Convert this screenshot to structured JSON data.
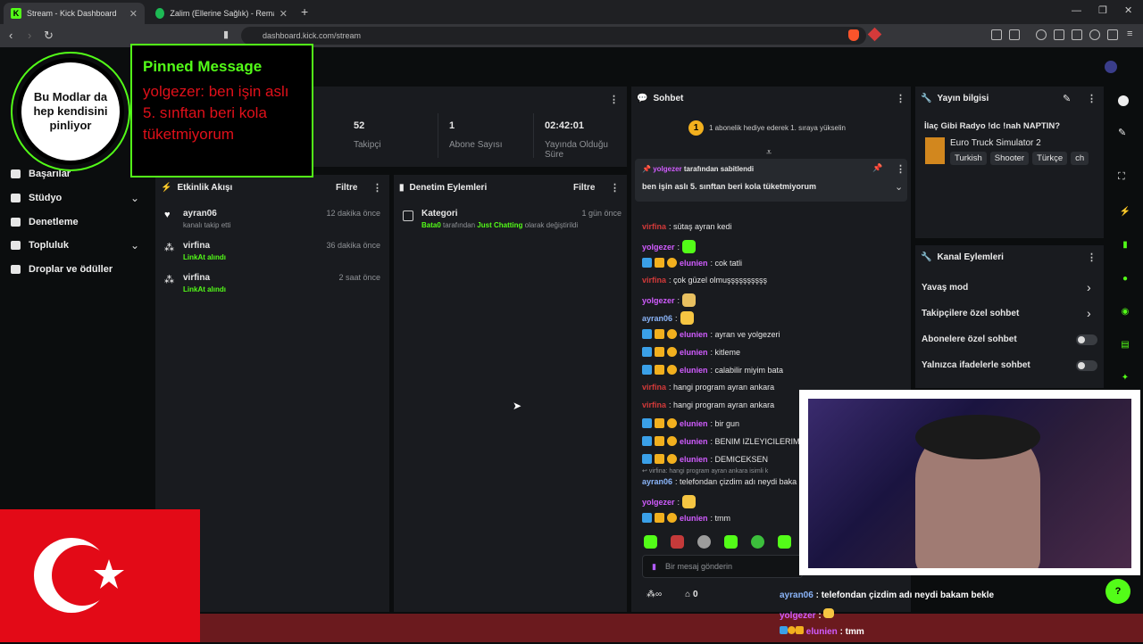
{
  "browser": {
    "tabs": [
      {
        "title": "Stream - Kick Dashboard",
        "icon": "kick-icon",
        "active": true
      },
      {
        "title": "Zalim (Ellerine Sağlık) - Remaster",
        "icon": "spotify-icon",
        "active": false
      }
    ],
    "url": "dashboard.kick.com/stream",
    "new_tab": "+"
  },
  "overlay": {
    "avatar_text": "Bu Modlar da hep kendisini pinliyor",
    "pinned_title": "Pinned Message",
    "pinned_text": "yolgezer: ben işin aslı 5. sınftan beri kola tüketmiyorum"
  },
  "sidebar": {
    "items": [
      {
        "label": "Başarılar"
      },
      {
        "label": "Stüdyo",
        "expandable": true
      },
      {
        "label": "Denetleme"
      },
      {
        "label": "Topluluk",
        "expandable": true
      },
      {
        "label": "Droplar ve ödüller"
      }
    ]
  },
  "stats": [
    {
      "value": "52",
      "label": "Takipçi"
    },
    {
      "value": "1",
      "label": "Abone Sayısı"
    },
    {
      "value": "02:42:01",
      "label": "Yayında Olduğu Süre"
    }
  ],
  "activity": {
    "title": "Etkinlik Akışı",
    "filter": "Filtre",
    "items": [
      {
        "user": "ayran06",
        "sub": "kanalı takip etti",
        "time": "12 dakika önce"
      },
      {
        "user": "virfina",
        "sub": "LinkAt alındı",
        "time": "36 dakika önce"
      },
      {
        "user": "virfina",
        "sub": "LinkAt alındı",
        "time": "2 saat önce"
      }
    ]
  },
  "moderation": {
    "title": "Denetim Eylemleri",
    "filter": "Filtre",
    "item": {
      "title": "Kategori",
      "time": "1 gün önce",
      "actor": "Bata0",
      "mid": " tarafından ",
      "category": "Just Chatting",
      "tail": " olarak değiştirildi"
    }
  },
  "chat": {
    "title": "Sohbet",
    "gift_banner": "1 abonelik hediye ederek 1. sıraya yükselin",
    "gift_rank": "1",
    "pinned_by_user": "yolgezer",
    "pinned_by_suffix": " tarafından sabitlendi",
    "pinned_text": "ben işin aslı 5. sınftan beri kola tüketmiyorum",
    "messages": [
      {
        "user": "virfina",
        "color": "red",
        "text": ": sütaş ayran kedi",
        "badges": false
      },
      {
        "user": "yolgezer",
        "color": "pink",
        "text": ":",
        "badges": false,
        "emote": true
      },
      {
        "user": "elunien",
        "color": "pink",
        "text": ": cok tatli",
        "badges": true
      },
      {
        "user": "virfina",
        "color": "red",
        "text": ": çok güzel olmuşşşşşşşşşş",
        "badges": false
      },
      {
        "user": "yolgezer",
        "color": "pink",
        "text": ":",
        "badges": false,
        "emote": true
      },
      {
        "user": "ayran06",
        "color": "blue",
        "text": ":",
        "badges": false,
        "emote": true
      },
      {
        "user": "elunien",
        "color": "pink",
        "text": ": ayran ve yolgezeri",
        "badges": true
      },
      {
        "user": "elunien",
        "color": "pink",
        "text": ": kitleme",
        "badges": true
      },
      {
        "user": "elunien",
        "color": "pink",
        "text": ": calabilir miyim bata",
        "badges": true
      },
      {
        "user": "virfina",
        "color": "red",
        "text": ": hangi program ayran ankara",
        "badges": false
      },
      {
        "user": "virfina",
        "color": "red",
        "text": ": hangi program ayran ankara",
        "badges": false
      },
      {
        "user": "elunien",
        "color": "pink",
        "text": ": bir gun",
        "badges": true
      },
      {
        "user": "elunien",
        "color": "pink",
        "text": ": BENIM IZLEYICILERIMI",
        "badges": true
      },
      {
        "user": "elunien",
        "color": "pink",
        "text": ": DEMICEKSEN",
        "badges": true
      }
    ],
    "reply_ref": "virfina: hangi program ayran ankara isimli k",
    "reply": {
      "user": "ayran06",
      "text": ": telefondan çizdim adı neydi baka"
    },
    "after": [
      {
        "user": "yolgezer",
        "color": "pink",
        "text": ":",
        "badges": false,
        "emote": true
      },
      {
        "user": "elunien",
        "color": "pink",
        "text": ": tmm",
        "badges": true
      }
    ],
    "input_placeholder": "Bir mesaj gönderin",
    "points": "0"
  },
  "stream_info": {
    "title": "Yayın bilgisi",
    "stream_title": "İlaç Gibi Radyo !dc !nah NAPTIN?",
    "game": "Euro Truck Simulator 2",
    "tags": [
      "Turkish",
      "Shooter",
      "Türkçe",
      "ch"
    ]
  },
  "channel_actions": {
    "title": "Kanal Eylemleri",
    "items": [
      {
        "label": "Yavaş mod",
        "type": "arrow"
      },
      {
        "label": "Takipçilere özel sohbet",
        "type": "arrow"
      },
      {
        "label": "Abonelere özel sohbet",
        "type": "toggle"
      },
      {
        "label": "Yalnızca ifadelerle sohbet",
        "type": "toggle"
      }
    ]
  },
  "stream_overlay_chat": [
    {
      "user": "ayran06",
      "text": " : telefondan çizdim adı neydi bakam bekle"
    },
    {
      "user": "yolgezer",
      "text": " :"
    },
    {
      "user": "elunien",
      "text": " : tmm"
    }
  ],
  "colors": {
    "accent": "#53fc18",
    "flag": "#e30a17",
    "panel": "#191b1f"
  }
}
